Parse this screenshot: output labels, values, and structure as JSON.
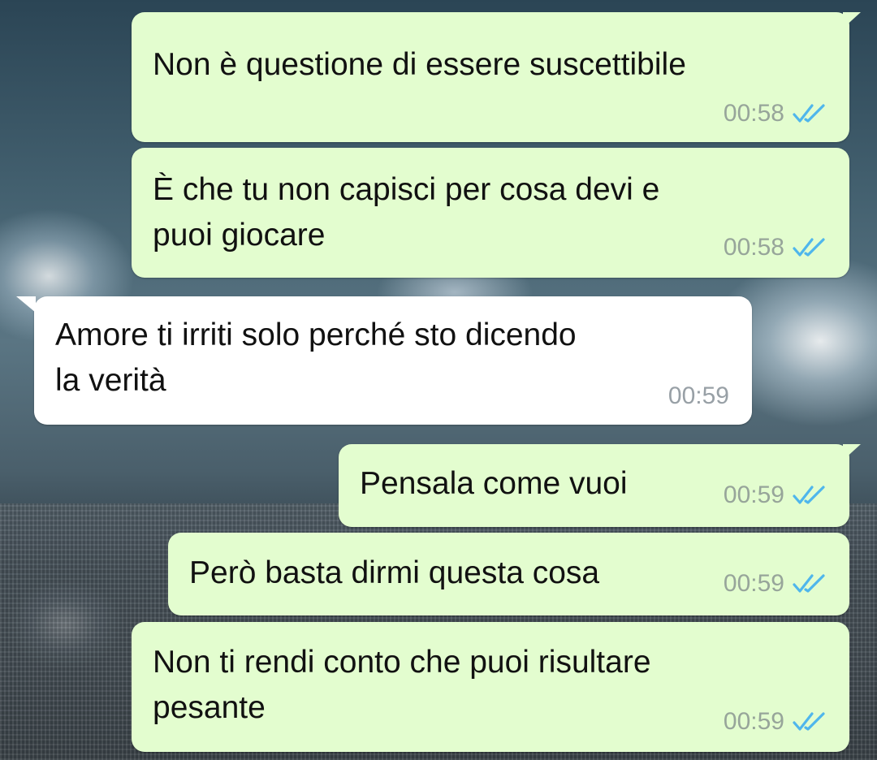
{
  "messages": [
    {
      "direction": "outgoing",
      "lines": [
        "Non è questione di essere suscettibile"
      ],
      "time": "00:58",
      "status": "read"
    },
    {
      "direction": "outgoing",
      "lines": [
        "È che tu non capisci per cosa devi e",
        "puoi giocare"
      ],
      "time": "00:58",
      "status": "read"
    },
    {
      "direction": "incoming",
      "lines": [
        "Amore ti irriti solo perché sto dicendo",
        "la verità"
      ],
      "time": "00:59"
    },
    {
      "direction": "outgoing",
      "lines": [
        "Pensala come vuoi"
      ],
      "time": "00:59",
      "status": "read"
    },
    {
      "direction": "outgoing",
      "lines": [
        "Però basta dirmi questa cosa"
      ],
      "time": "00:59",
      "status": "read"
    },
    {
      "direction": "outgoing",
      "lines": [
        "Non ti rendi conto che puoi risultare",
        "pesante"
      ],
      "time": "00:59",
      "status": "read"
    }
  ],
  "colors": {
    "outgoing_bubble": "#e3fdcf",
    "incoming_bubble": "#ffffff",
    "read_ticks": "#4fb6ec",
    "timestamp": "#97a59a"
  },
  "icons": {
    "read_receipt": "double-check-icon"
  }
}
